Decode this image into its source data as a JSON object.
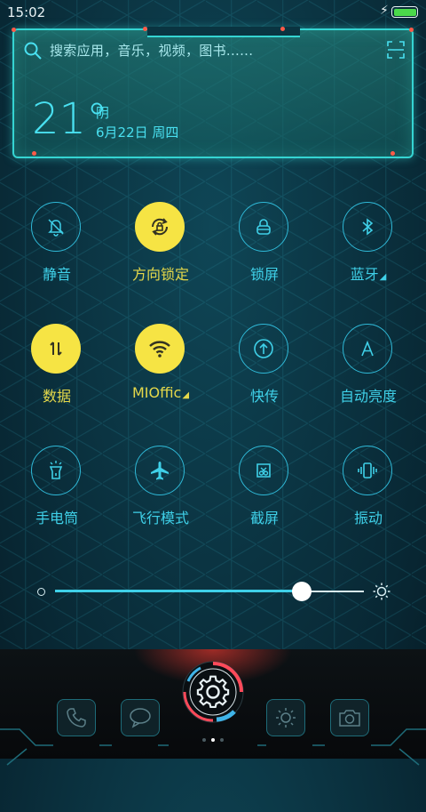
{
  "status_bar": {
    "time": "15:02",
    "battery_charging": true,
    "battery_level": 1.0
  },
  "widget": {
    "search_placeholder": "搜索应用，音乐，视频，图书......",
    "temperature": "21°",
    "weather": "阴",
    "date": "6月22日 周四"
  },
  "toggles": [
    {
      "label": "静音",
      "icon": "mute-bell-icon",
      "on": false
    },
    {
      "label": "方向锁定",
      "icon": "rotation-lock-icon",
      "on": true
    },
    {
      "label": "锁屏",
      "icon": "lock-icon",
      "on": false
    },
    {
      "label": "蓝牙",
      "icon": "bluetooth-icon",
      "on": false,
      "has_menu": true
    },
    {
      "label": "数据",
      "icon": "mobile-data-icon",
      "on": true
    },
    {
      "label": "MIOffic",
      "icon": "wifi-icon",
      "on": true,
      "has_menu": true
    },
    {
      "label": "快传",
      "icon": "quick-transfer-icon",
      "on": false
    },
    {
      "label": "自动亮度",
      "icon": "auto-brightness-icon",
      "on": false
    },
    {
      "label": "手电筒",
      "icon": "flashlight-icon",
      "on": false
    },
    {
      "label": "飞行模式",
      "icon": "airplane-icon",
      "on": false
    },
    {
      "label": "截屏",
      "icon": "screenshot-icon",
      "on": false
    },
    {
      "label": "振动",
      "icon": "vibrate-icon",
      "on": false
    }
  ],
  "brightness": {
    "level": 0.8
  },
  "dock": {
    "apps": [
      "phone-icon",
      "messages-icon",
      "settings-gear-icon",
      "brightness-icon",
      "camera-icon"
    ],
    "page_count": 3,
    "active_page": 1
  },
  "colors": {
    "accent": "#3fd0e8",
    "toggle_on": "#f6e444",
    "widget_border": "#35d4d2"
  }
}
